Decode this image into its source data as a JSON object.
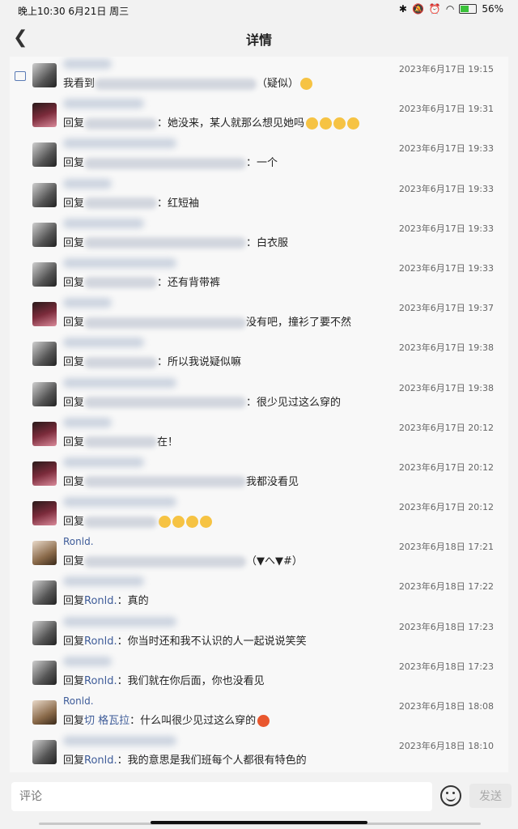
{
  "status": {
    "time": "晚上10:30",
    "date": "6月21日 周三",
    "battery": "56%"
  },
  "header": {
    "title": "详情"
  },
  "comments": [
    {
      "av": "a",
      "name": "",
      "time": "2023年6月17日 19:15",
      "pre": "我看到",
      "suffix": "（疑似）",
      "emoji": 1,
      "icon": true
    },
    {
      "av": "b",
      "name": "",
      "time": "2023年6月17日 19:31",
      "pre": "回复",
      "suffix": "：她没来，某人就那么想见她吗",
      "emoji": 4
    },
    {
      "av": "a",
      "name": "",
      "time": "2023年6月17日 19:33",
      "pre": "回复",
      "suffix": "：一个"
    },
    {
      "av": "a",
      "name": "",
      "time": "2023年6月17日 19:33",
      "pre": "回复",
      "suffix": "：红短袖"
    },
    {
      "av": "a",
      "name": "",
      "time": "2023年6月17日 19:33",
      "pre": "回复",
      "suffix": "：白衣服"
    },
    {
      "av": "a",
      "name": "",
      "time": "2023年6月17日 19:33",
      "pre": "回复",
      "suffix": "：还有背带裤"
    },
    {
      "av": "b",
      "name": "",
      "time": "2023年6月17日 19:37",
      "pre": "回复",
      "suffix": "没有吧，撞衫了要不然"
    },
    {
      "av": "a",
      "name": "",
      "time": "2023年6月17日 19:38",
      "pre": "回复",
      "suffix": "：所以我说疑似嘛"
    },
    {
      "av": "a",
      "name": "",
      "time": "2023年6月17日 19:38",
      "pre": "回复",
      "suffix": "：很少见过这么穿的"
    },
    {
      "av": "b",
      "name": "",
      "time": "2023年6月17日 20:12",
      "pre": "回复",
      "suffix": "在！"
    },
    {
      "av": "b",
      "name": "",
      "time": "2023年6月17日 20:12",
      "pre": "回复",
      "suffix": "我都没看见"
    },
    {
      "av": "b",
      "name": "",
      "time": "2023年6月17日 20:12",
      "pre": "回复",
      "suffix": "",
      "emoji": 4
    },
    {
      "av": "c",
      "name": "Ronld.",
      "time": "2023年6月18日 17:21",
      "pre": "回复",
      "suffix": "（▼へ▼#）"
    },
    {
      "av": "a",
      "name": "",
      "time": "2023年6月18日 17:22",
      "pre": "回复",
      "hl": "Ronld.",
      "suffix": "：真的"
    },
    {
      "av": "a",
      "name": "",
      "time": "2023年6月18日 17:23",
      "pre": "回复",
      "hl": "Ronld.",
      "suffix": "：你当时还和我不认识的人一起说说笑笑"
    },
    {
      "av": "a",
      "name": "",
      "time": "2023年6月18日 17:23",
      "pre": "回复",
      "hl": "Ronld.",
      "suffix": "：我们就在你后面，你也没看见"
    },
    {
      "av": "c",
      "name": "Ronld.",
      "time": "2023年6月18日 18:08",
      "pre": "回复",
      "hl": "切 格瓦拉",
      "suffix": "：什么叫很少见过这么穿的",
      "emoji_r": 1
    },
    {
      "av": "a",
      "name": "",
      "time": "2023年6月18日 18:10",
      "pre": "回复",
      "hl": "Ronld.",
      "suffix": "：我的意思是我们班每个人都很有特色的"
    }
  ],
  "input": {
    "placeholder": "评论"
  },
  "send_label": "发送",
  "icons": {
    "back": "chevron-left-icon",
    "emoji": "smile-icon",
    "comment": "comment-icon"
  }
}
